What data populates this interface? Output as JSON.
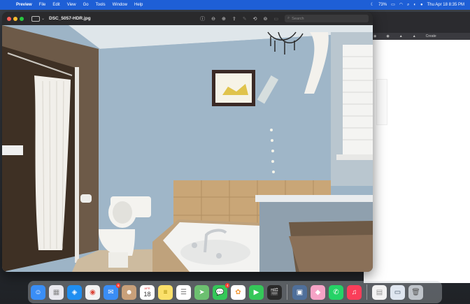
{
  "menubar": {
    "app_name": "Preview",
    "items": [
      "File",
      "Edit",
      "View",
      "Go",
      "Tools",
      "Window",
      "Help"
    ],
    "battery": "73%",
    "datetime": "Thu Apr 18  8:35 PM"
  },
  "window": {
    "filename": "DSC_5057-HDR.jpg",
    "search_placeholder": "Search"
  },
  "bg_window": {
    "tab_label": "Create"
  },
  "dock": {
    "items": [
      {
        "name": "finder",
        "color": "#3a8ef6"
      },
      {
        "name": "launchpad",
        "color": "#e9e9ef"
      },
      {
        "name": "safari",
        "color": "#1f8ef1"
      },
      {
        "name": "chrome",
        "color": "#f2f2f2"
      },
      {
        "name": "mail",
        "color": "#3a8df5",
        "badge": "6"
      },
      {
        "name": "contacts",
        "color": "#c8a07a"
      },
      {
        "name": "calendar",
        "color": "#ffffff",
        "month": "APR",
        "day": "18"
      },
      {
        "name": "notes",
        "color": "#fbe06a"
      },
      {
        "name": "reminders",
        "color": "#ffffff"
      },
      {
        "name": "maps",
        "color": "#6cc070"
      },
      {
        "name": "messages",
        "color": "#35c759",
        "badge": "4"
      },
      {
        "name": "photos",
        "color": "#ffffff"
      },
      {
        "name": "facetime",
        "color": "#35c759"
      },
      {
        "name": "final-cut",
        "color": "#2a2a2a"
      },
      {
        "name": "preview",
        "color": "#4f6f9a"
      },
      {
        "name": "pixelmator",
        "color": "#f5a3c6"
      },
      {
        "name": "whatsapp",
        "color": "#25d366"
      },
      {
        "name": "music",
        "color": "#fa3e5a"
      },
      {
        "name": "document",
        "color": "#f2f2f2"
      },
      {
        "name": "screenshot-file",
        "color": "#dfe6f0"
      },
      {
        "name": "trash",
        "color": "#bfc4ca"
      }
    ]
  },
  "colors": {
    "menubar": "#1e5fd6",
    "wall": "#9db4c6",
    "tile": "#c9a677"
  }
}
